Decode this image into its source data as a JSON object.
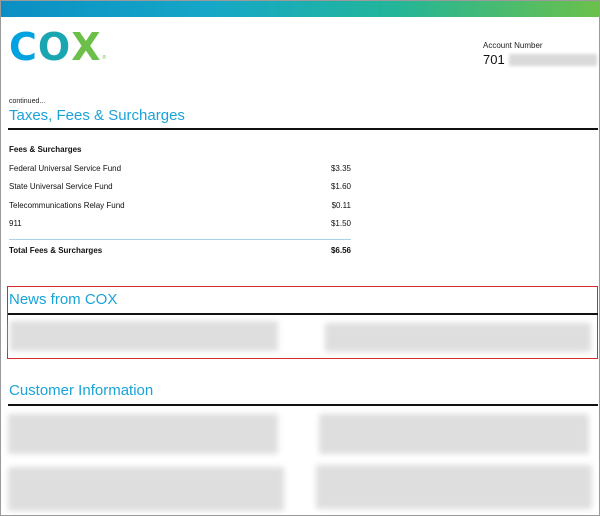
{
  "brand": {
    "logo_letters": [
      "C",
      "O",
      "X"
    ],
    "logo_registered": "®",
    "colors": {
      "blue": "#00a2e0",
      "teal": "#1aa6b0",
      "green": "#6cc04a",
      "heading": "#1aa3d9",
      "highlight": "#d52b2b"
    }
  },
  "account": {
    "label": "Account Number",
    "value_prefix": "701"
  },
  "continued_note": "continued...",
  "taxes_section": {
    "title": "Taxes, Fees & Surcharges",
    "subheading": "Fees & Surcharges",
    "items": [
      {
        "label": "Federal Universal Service Fund",
        "amount": "$3.35"
      },
      {
        "label": "State Universal Service Fund",
        "amount": "$1.60"
      },
      {
        "label": "Telecommunications Relay Fund",
        "amount": "$0.11"
      },
      {
        "label": "911",
        "amount": "$1.50"
      }
    ],
    "total_label": "Total Fees & Surcharges",
    "total_amount": "$6.56"
  },
  "news_section": {
    "title": "News from COX"
  },
  "customer_section": {
    "title": "Customer Information"
  }
}
